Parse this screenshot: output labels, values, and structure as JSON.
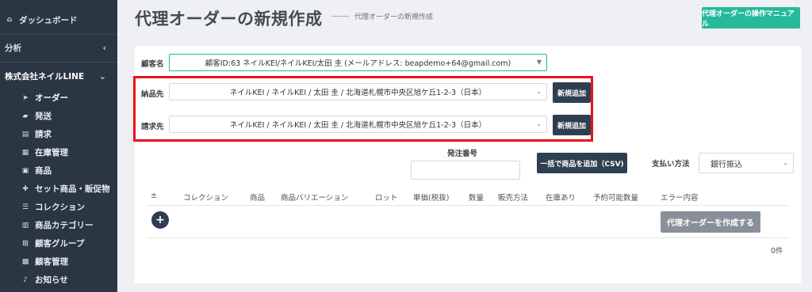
{
  "sidebar": {
    "dashboard": "ダッシュボード",
    "analysis": "分析",
    "company": "株式会社ネイルLINE",
    "items": [
      {
        "label": "オーダー",
        "icon": "paper-plane-icon"
      },
      {
        "label": "発送",
        "icon": "truck-icon"
      },
      {
        "label": "請求",
        "icon": "document-icon"
      },
      {
        "label": "在庫管理",
        "icon": "table-icon"
      },
      {
        "label": "商品",
        "icon": "bag-icon"
      },
      {
        "label": "セット商品・販促物",
        "icon": "gift-icon"
      },
      {
        "label": "コレクション",
        "icon": "list-icon"
      },
      {
        "label": "商品カテゴリー",
        "icon": "grid-icon"
      },
      {
        "label": "顧客グループ",
        "icon": "sitemap-icon"
      },
      {
        "label": "顧客管理",
        "icon": "contact-icon"
      },
      {
        "label": "お知らせ",
        "icon": "bell-icon"
      }
    ]
  },
  "header": {
    "title": "代理オーダーの新規作成",
    "subtitle": "代理オーダーの新規作成",
    "manual_button": "代理オーダーの操作マニュアル"
  },
  "form": {
    "customer_label": "顧客名",
    "customer_value": "顧客ID:63 ネイルKEI/ネイルKEI/太田 圭 (メールアドレス: beapdemo+64@gmail.com)",
    "delivery_label": "納品先",
    "delivery_value": "ネイルKEI / ネイルKEI / 太田 圭 / 北海道札幌市中央区旭ケ丘1-2-3（日本）",
    "billing_label": "請求先",
    "billing_value": "ネイルKEI / ネイルKEI / 太田 圭 / 北海道札幌市中央区旭ケ丘1-2-3（日本）",
    "add_new_label": "新規追加",
    "order_number_label": "発注番号",
    "order_number_value": "",
    "csv_button": "一括で商品を追加（CSV)",
    "payment_label": "支払い方法",
    "payment_value": "銀行振込"
  },
  "table": {
    "columns": [
      "±",
      "コレクション",
      "商品",
      "商品バリエーション",
      "ロット",
      "単価(税抜)",
      "数量",
      "販売方法",
      "在庫あり",
      "予約可能数量",
      "エラー内容"
    ],
    "create_button": "代理オーダーを作成する",
    "count": "0件"
  },
  "colors": {
    "sidebar_bg": "#2b3643",
    "accent": "#26b99a",
    "highlight": "#e8141b",
    "dark_button": "#2f3f52"
  }
}
